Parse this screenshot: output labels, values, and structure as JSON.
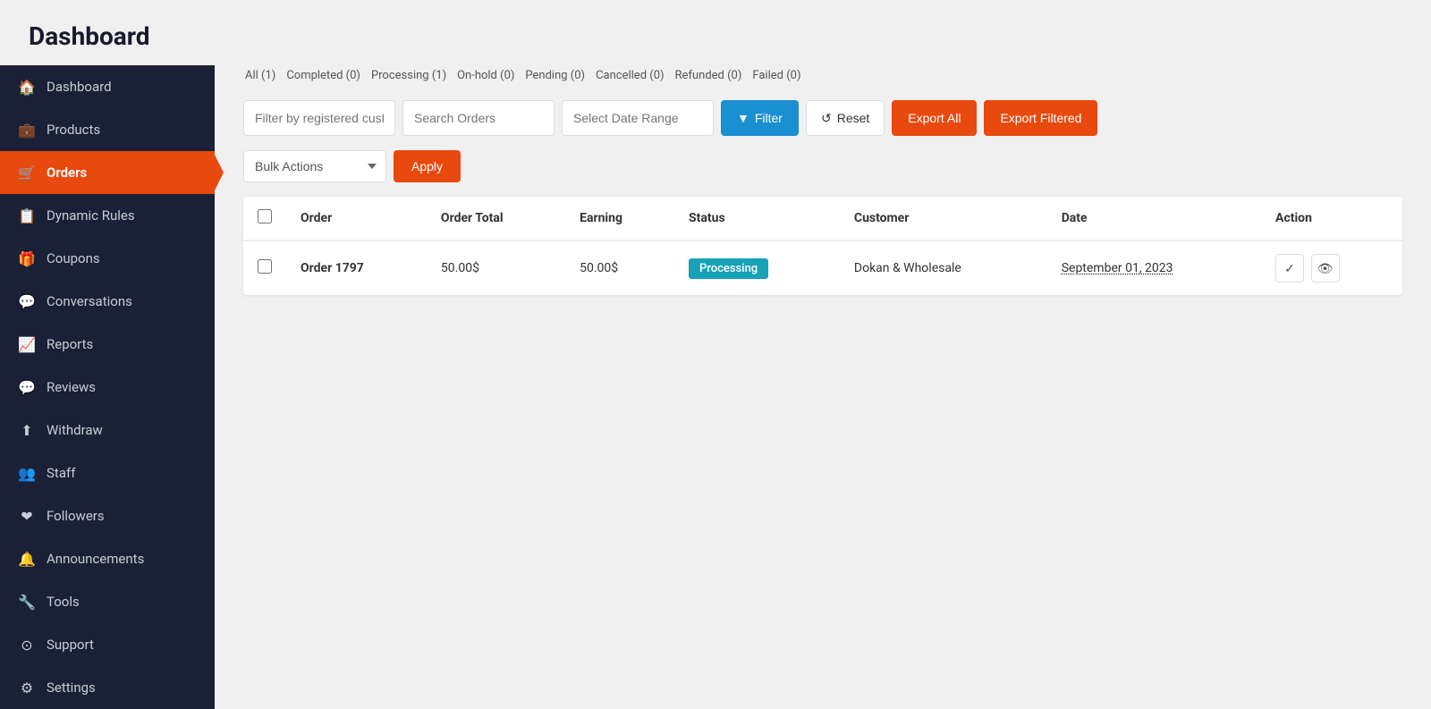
{
  "page": {
    "title": "Dashboard"
  },
  "sidebar": {
    "items": [
      {
        "id": "dashboard",
        "label": "Dashboard",
        "icon": "🏠",
        "active": false
      },
      {
        "id": "products",
        "label": "Products",
        "icon": "💼",
        "active": false
      },
      {
        "id": "orders",
        "label": "Orders",
        "icon": "🛒",
        "active": true
      },
      {
        "id": "dynamic-rules",
        "label": "Dynamic Rules",
        "icon": "📋",
        "active": false
      },
      {
        "id": "coupons",
        "label": "Coupons",
        "icon": "🎁",
        "active": false
      },
      {
        "id": "conversations",
        "label": "Conversations",
        "icon": "💬",
        "active": false
      },
      {
        "id": "reports",
        "label": "Reports",
        "icon": "📈",
        "active": false
      },
      {
        "id": "reviews",
        "label": "Reviews",
        "icon": "💬",
        "active": false
      },
      {
        "id": "withdraw",
        "label": "Withdraw",
        "icon": "⬆",
        "active": false
      },
      {
        "id": "staff",
        "label": "Staff",
        "icon": "👥",
        "active": false
      },
      {
        "id": "followers",
        "label": "Followers",
        "icon": "❤",
        "active": false
      },
      {
        "id": "announcements",
        "label": "Announcements",
        "icon": "🔔",
        "active": false
      },
      {
        "id": "tools",
        "label": "Tools",
        "icon": "🔧",
        "active": false
      },
      {
        "id": "support",
        "label": "Support",
        "icon": "⊙",
        "active": false
      },
      {
        "id": "settings",
        "label": "Settings",
        "icon": "⚙",
        "active": false
      }
    ]
  },
  "filter_tabs": [
    {
      "label": "All (1)",
      "id": "all"
    },
    {
      "label": "Completed (0)",
      "id": "completed"
    },
    {
      "label": "Processing (1)",
      "id": "processing"
    },
    {
      "label": "On-hold (0)",
      "id": "on-hold"
    },
    {
      "label": "Pending (0)",
      "id": "pending"
    },
    {
      "label": "Cancelled (0)",
      "id": "cancelled"
    },
    {
      "label": "Refunded (0)",
      "id": "refunded"
    },
    {
      "label": "Failed (0)",
      "id": "failed"
    }
  ],
  "toolbar": {
    "filter_placeholder": "Filter by registered cust...",
    "search_placeholder": "Search Orders",
    "date_placeholder": "Select Date Range",
    "filter_label": "Filter",
    "reset_label": "Reset",
    "export_all_label": "Export All",
    "export_filtered_label": "Export Filtered"
  },
  "bulk_actions": {
    "placeholder": "Bulk Actions",
    "apply_label": "Apply"
  },
  "table": {
    "columns": [
      "",
      "Order",
      "Order Total",
      "Earning",
      "Status",
      "Customer",
      "Date",
      "Action"
    ],
    "rows": [
      {
        "id": "1797",
        "order_label": "Order 1797",
        "order_total": "50.00$",
        "earning": "50.00$",
        "status": "Processing",
        "status_class": "status-processing",
        "customer": "Dokan & Wholesale",
        "date": "September 01, 2023"
      }
    ]
  }
}
